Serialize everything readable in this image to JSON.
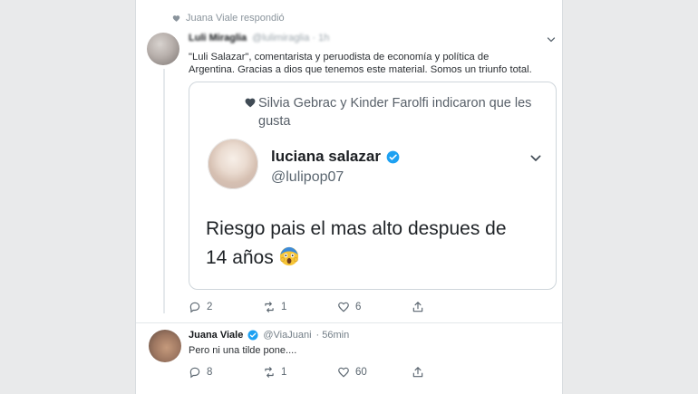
{
  "context": {
    "label": "Juana Viale respondió"
  },
  "tweet1": {
    "name": "Luli Miraglia",
    "handle": "@lulimiraglia · 1h",
    "text_lines": [
      "\"Luli Salazar\", comentarista y peruodista de economía y política de",
      "Argentina. Gracias a dios que tenemos este material. Somos un triunfo total."
    ],
    "actions": {
      "replies": "2",
      "retweets": "1",
      "likes": "6"
    }
  },
  "quote": {
    "context": "Silvia Gebrac y Kinder Farolfi indicaron que les gusta",
    "name": "luciana salazar",
    "handle": "@lulipop07",
    "text_line1": "Riesgo pais el mas alto despues de",
    "text_line2": "14 años"
  },
  "tweet2": {
    "name": "Juana Viale",
    "handle": "@ViaJuani",
    "time": "· 56min",
    "text": "Pero ni una tilde pone....",
    "actions": {
      "replies": "8",
      "retweets": "1",
      "likes": "60"
    }
  },
  "colors": {
    "verified": "#1da1f2",
    "background": "#e9eaeb",
    "card": "#ffffff"
  },
  "icons": [
    "heart-icon",
    "chevron-down-icon",
    "verified-badge-icon",
    "reply-icon",
    "retweet-icon",
    "like-icon",
    "share-icon",
    "screaming-face-emoji"
  ]
}
